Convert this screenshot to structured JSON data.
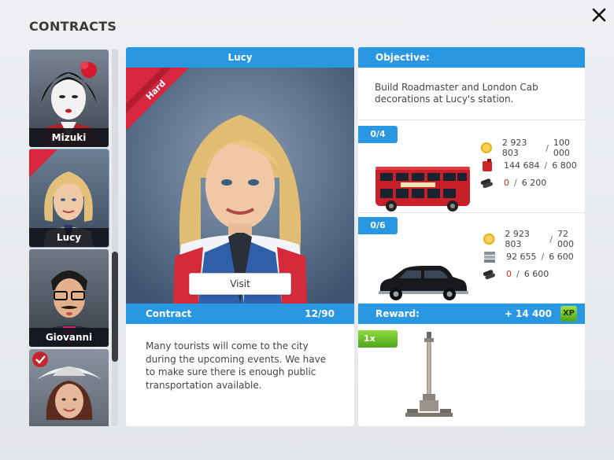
{
  "window": {
    "title": "CONTRACTS"
  },
  "sidebar": {
    "characters": [
      {
        "name": "Mizuki",
        "selected": false
      },
      {
        "name": "Lucy",
        "selected": true
      },
      {
        "name": "Giovanni",
        "selected": false
      },
      {
        "name": "",
        "selected": false
      }
    ]
  },
  "character_panel": {
    "name": "Lucy",
    "difficulty": "Hard",
    "visit_label": "Visit",
    "contract_label": "Contract",
    "contract_progress": "12/90",
    "description": "Many tourists will come to the city during the upcoming events. We have to make sure there is enough public transportation available."
  },
  "objective_panel": {
    "header": "Objective:",
    "text": "Build Roadmaster and London Cab decorations at Lucy's station.",
    "tasks": [
      {
        "progress": "0/4",
        "vehicle_icon": "red-double-decker-bus",
        "resources": [
          {
            "icon": "coin-icon",
            "current": "2 923 803",
            "required": "100 000",
            "insufficient": false
          },
          {
            "icon": "fuel-canister-icon",
            "current": "144 684",
            "required": "6 800",
            "insufficient": false
          },
          {
            "icon": "steel-pipes-icon",
            "current": "0",
            "required": "6 200",
            "insufficient": true
          }
        ]
      },
      {
        "progress": "0/6",
        "vehicle_icon": "black-london-cab",
        "resources": [
          {
            "icon": "coin-icon",
            "current": "2 923 803",
            "required": "72 000",
            "insufficient": false
          },
          {
            "icon": "steel-plates-icon",
            "current": "92 655",
            "required": "6 600",
            "insufficient": false
          },
          {
            "icon": "steel-pipes-icon",
            "current": "0",
            "required": "6 600",
            "insufficient": true
          }
        ]
      }
    ],
    "reward_label": "Reward:",
    "reward_value": "+ 14 400",
    "reward_unit": "XP",
    "multiplier": "1x",
    "reward_icon": "column-monument"
  },
  "colors": {
    "accent_blue": "#2a97e2",
    "hard_ribbon": "#d7263d",
    "insufficient": "#d12a2a",
    "xp_green": "#6cc02a"
  }
}
